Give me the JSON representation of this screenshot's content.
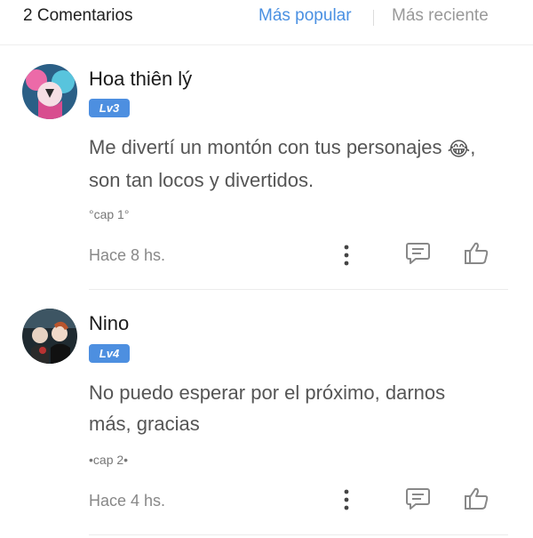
{
  "header": {
    "comment_count": "2 Comentarios",
    "sort_popular": "Más popular",
    "sort_recent": "Más reciente"
  },
  "colors": {
    "accent": "#4a90e2",
    "level_badge": "#4d8fe0",
    "muted_text": "#999999"
  },
  "comments": [
    {
      "username": "Hoa thiên lý",
      "level": "Lv3",
      "text_line1": "Me divertí un montón con tus personajes",
      "emoji": "😂",
      "text_line1_end": ",",
      "text_line2": "son tan locos y divertidos.",
      "tag": "°cap 1°",
      "time": "Hace 8 hs.",
      "icons": [
        "more-vertical-icon",
        "comment-icon",
        "thumbs-up-icon"
      ]
    },
    {
      "username": "Nino",
      "level": "Lv4",
      "text_line1": "No puedo esperar por el próximo, darnos",
      "text_line2": "más, gracias",
      "tag": "•cap 2•",
      "time": "Hace 4 hs.",
      "icons": [
        "more-vertical-icon",
        "comment-icon",
        "thumbs-up-icon"
      ]
    }
  ]
}
